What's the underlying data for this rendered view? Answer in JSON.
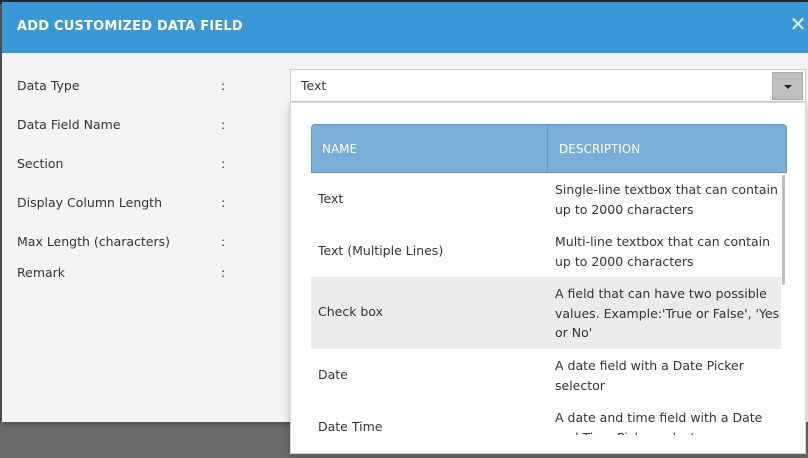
{
  "dialog": {
    "title": "ADD CUSTOMIZED DATA FIELD"
  },
  "form": {
    "fields": [
      {
        "label": "Data Type",
        "colon": ":"
      },
      {
        "label": "Data Field Name",
        "colon": ":"
      },
      {
        "label": "Section",
        "colon": ":"
      },
      {
        "label": "Display Column Length",
        "colon": ":"
      },
      {
        "label": "Max Length (characters)",
        "colon": ":"
      },
      {
        "label": "Remark",
        "colon": ":"
      }
    ],
    "data_type_value": "Text"
  },
  "dropdown": {
    "headers": {
      "name": "NAME",
      "description": "DESCRIPTION"
    },
    "rows": [
      {
        "name": "Text",
        "description": "Single-line textbox that can contain up to 2000 characters"
      },
      {
        "name": "Text (Multiple Lines)",
        "description": "Multi-line textbox that can contain up to 2000 characters"
      },
      {
        "name": "Check box",
        "description": "A field that can have two possible values. Example:'True or False', 'Yes or No'"
      },
      {
        "name": "Date",
        "description": "A date field with a Date Picker selector"
      },
      {
        "name": "Date Time",
        "description": "A date and time field with a Date and Time Picker selector"
      }
    ]
  },
  "colors": {
    "header_bg": "#3a98d6",
    "table_header_bg": "#7aaed6",
    "highlight_row_bg": "#ebebeb"
  },
  "icons": {
    "close": "close-icon",
    "dropdown_arrow": "chevron-down-icon"
  }
}
